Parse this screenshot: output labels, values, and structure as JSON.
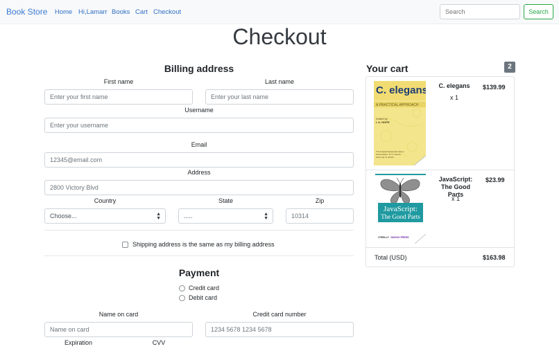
{
  "navbar": {
    "brand": "Book Store",
    "links": [
      "Home",
      "Hi,Lamarr",
      "Books",
      "Cart",
      "Checkout"
    ],
    "search_placeholder": "Search",
    "search_button": "Search"
  },
  "page_title": "Checkout",
  "billing": {
    "heading": "Billing address",
    "first_name": {
      "label": "First name",
      "placeholder": "Enter your first name"
    },
    "last_name": {
      "label": "Last name",
      "placeholder": "Enter your last name"
    },
    "username": {
      "label": "Username",
      "placeholder": "Enter your username"
    },
    "email": {
      "label": "Email",
      "placeholder": "12345@email.com"
    },
    "address": {
      "label": "Address",
      "placeholder": "2800 Victory Blvd"
    },
    "country": {
      "label": "Country",
      "value": "Choose..."
    },
    "state": {
      "label": "State",
      "value": "....."
    },
    "zip": {
      "label": "Zip",
      "placeholder": "10314"
    },
    "same_address_label": "Shipping address is the same as my billing address"
  },
  "payment": {
    "heading": "Payment",
    "methods": [
      "Credit card",
      "Debit card"
    ],
    "name_on_card": {
      "label": "Name on card",
      "placeholder": "Name on card"
    },
    "card_number": {
      "label": "Credit card number",
      "placeholder": "1234 5678 1234 5678"
    },
    "expiration_label": "Expiration",
    "cvv_label": "CVV"
  },
  "cart": {
    "heading": "Your cart",
    "count": "2",
    "items": [
      {
        "name": "C. elegans",
        "qty": "x 1",
        "price": "$139.99",
        "cover": {
          "title": "C. elegans",
          "subtitle": "A PRACTICAL APPROACH",
          "editor_line": "Edited by",
          "editor": "I. A. HOPE",
          "color": "#f3e58c",
          "series_line": "The Practical Approach Series",
          "series_edition": "Series Editor: B. D. Hames",
          "series_url": "www.oup.co.uk/pas"
        }
      },
      {
        "name": "JavaScript: The Good Parts",
        "qty": "x 1",
        "price": "$23.99",
        "cover": {
          "title_line1": "JavaScript:",
          "title_line2": "The Good Parts",
          "publisher": "O'REILLY",
          "imprint": "YAHOO! PRESS",
          "color": "#1f9aa0"
        }
      }
    ],
    "total_label": "Total (USD)",
    "total_value": "$163.98"
  },
  "colors": {
    "brand": "#3a7bd5",
    "link": "#2f6fc4",
    "search_button": "#28a745",
    "badge": "#6c757d"
  }
}
